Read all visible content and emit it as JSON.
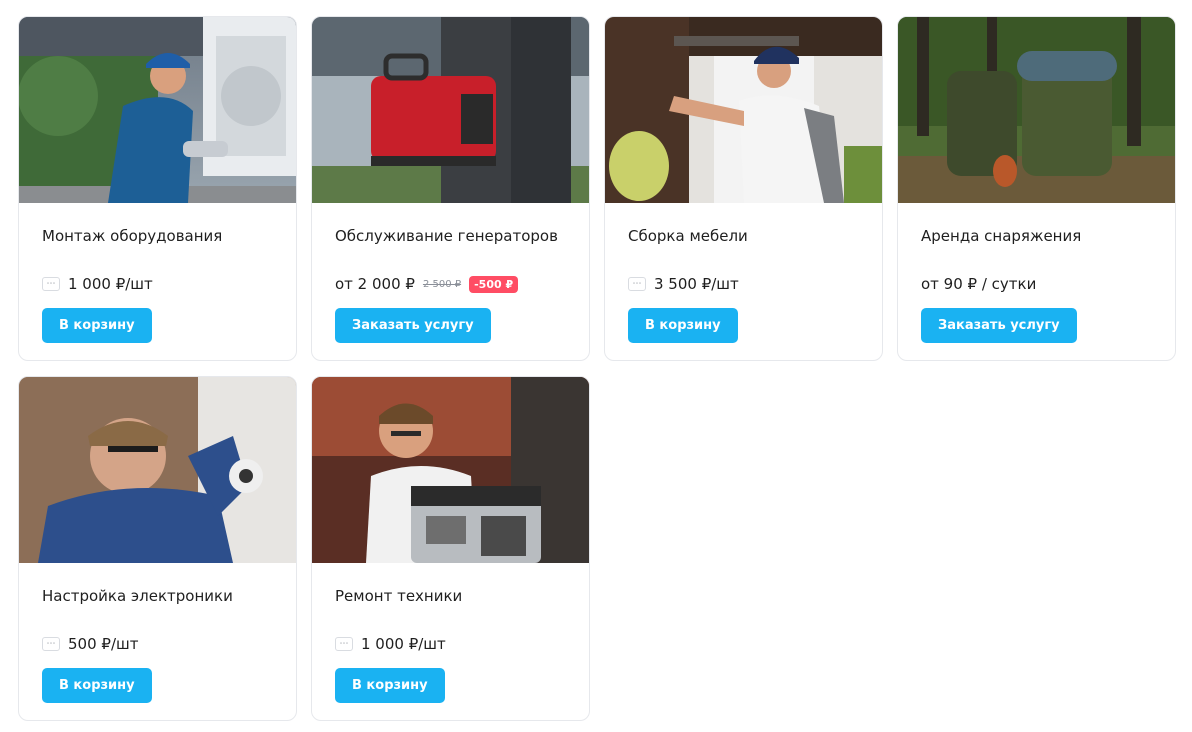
{
  "products": [
    {
      "title": "Монтаж оборудования",
      "qty_icon": "⋯",
      "price": "1 000 ₽/шт",
      "button": "В корзину"
    },
    {
      "title": "Обслуживание генераторов",
      "price": "от 2 000 ₽",
      "old_price": "2 500 ₽",
      "discount": "-500 ₽",
      "button": "Заказать услугу"
    },
    {
      "title": "Сборка мебели",
      "qty_icon": "⋯",
      "price": "3 500 ₽/шт",
      "button": "В корзину"
    },
    {
      "title": "Аренда снаряжения",
      "price": "от 90 ₽ / сутки",
      "button": "Заказать услугу"
    },
    {
      "title": "Настройка электроники",
      "qty_icon": "⋯",
      "price": "500 ₽/шт",
      "button": "В корзину"
    },
    {
      "title": "Ремонт техники",
      "qty_icon": "⋯",
      "price": "1 000 ₽/шт",
      "button": "В корзину"
    }
  ],
  "colors": {
    "button_bg": "#1ab2f2",
    "discount_bg": "#ff4d64",
    "card_border": "#e6e8ec"
  }
}
